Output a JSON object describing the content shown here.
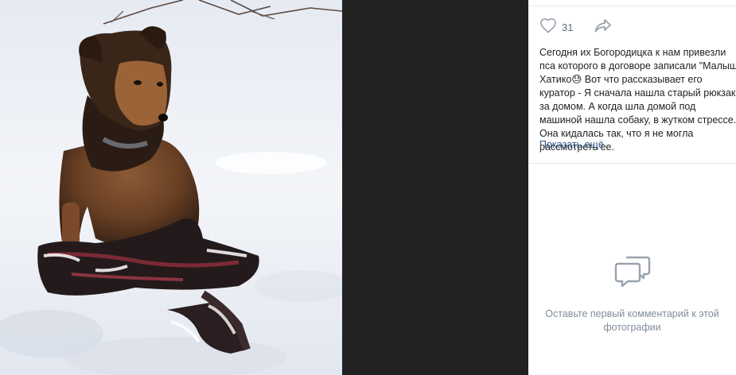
{
  "photo": {
    "subject": "dog-in-snow-with-backpack-photo"
  },
  "actions": {
    "like_icon": "heart-icon",
    "likes_count": "31",
    "share_icon": "share-arrow-icon"
  },
  "post": {
    "description": "Сегодня их Богородицка к нам привезли пса которого в договоре записали \"Малыш Хатико😓 Вот что рассказывает его куратор - Я сначала нашла старый рюкзак за домом. А когда шла домой под машиной нашла собаку, в жутком стрессе. Она кидалась так, что я не могла рассмотреть ее.",
    "show_more": "Показать ещё"
  },
  "comments": {
    "icon": "comments-icon",
    "empty_text": "Оставьте первый комментарий к этой фотографии"
  },
  "colors": {
    "letterbox": "#222222",
    "link": "#2a5885",
    "muted": "#818c99",
    "icon": "#99a2ad",
    "text": "#222222",
    "divider": "#e7e8ec"
  }
}
